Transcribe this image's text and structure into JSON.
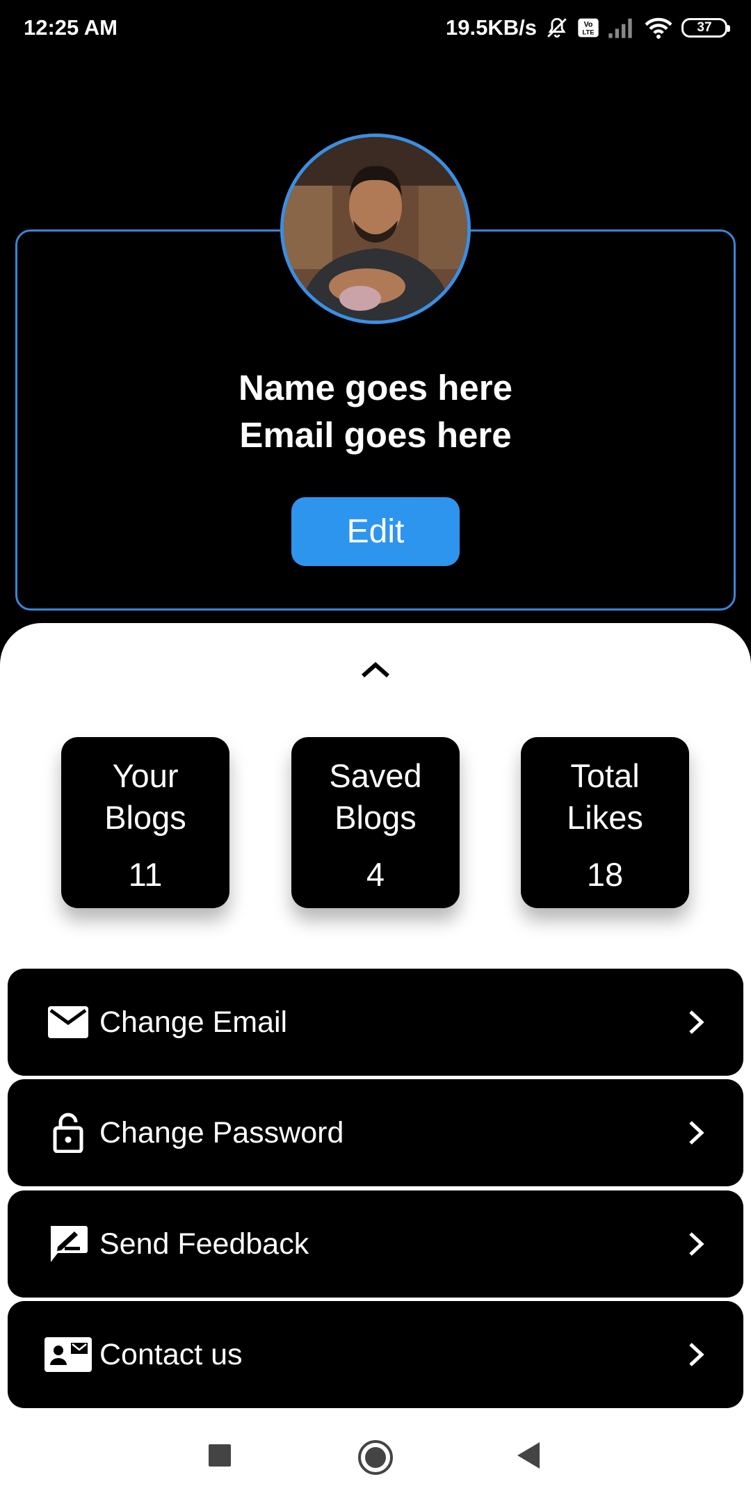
{
  "status_bar": {
    "time": "12:25 AM",
    "network_speed": "19.5KB/s",
    "battery_level": "37",
    "icons": [
      "mute-bell-icon",
      "volte-icon",
      "signal-icon",
      "wifi-icon",
      "battery-icon"
    ]
  },
  "profile": {
    "name": "Name goes here",
    "email": "Email goes here",
    "edit_label": "Edit",
    "accent_color": "#2e95ee",
    "border_color": "#3a86d6"
  },
  "sheet": {
    "expand_icon": "chevron-up-icon",
    "stats": [
      {
        "label": "Your Blogs",
        "value": "11"
      },
      {
        "label": "Saved Blogs",
        "value": "4"
      },
      {
        "label": "Total Likes",
        "value": "18"
      }
    ],
    "menu": [
      {
        "label": "Change Email",
        "icon": "mail-icon"
      },
      {
        "label": "Change Password",
        "icon": "lock-icon"
      },
      {
        "label": "Send Feedback",
        "icon": "feedback-icon"
      },
      {
        "label": "Contact us",
        "icon": "contact-card-icon"
      }
    ]
  },
  "nav_bar": {
    "buttons": [
      "recents-square-icon",
      "home-circle-icon",
      "back-triangle-icon"
    ]
  }
}
